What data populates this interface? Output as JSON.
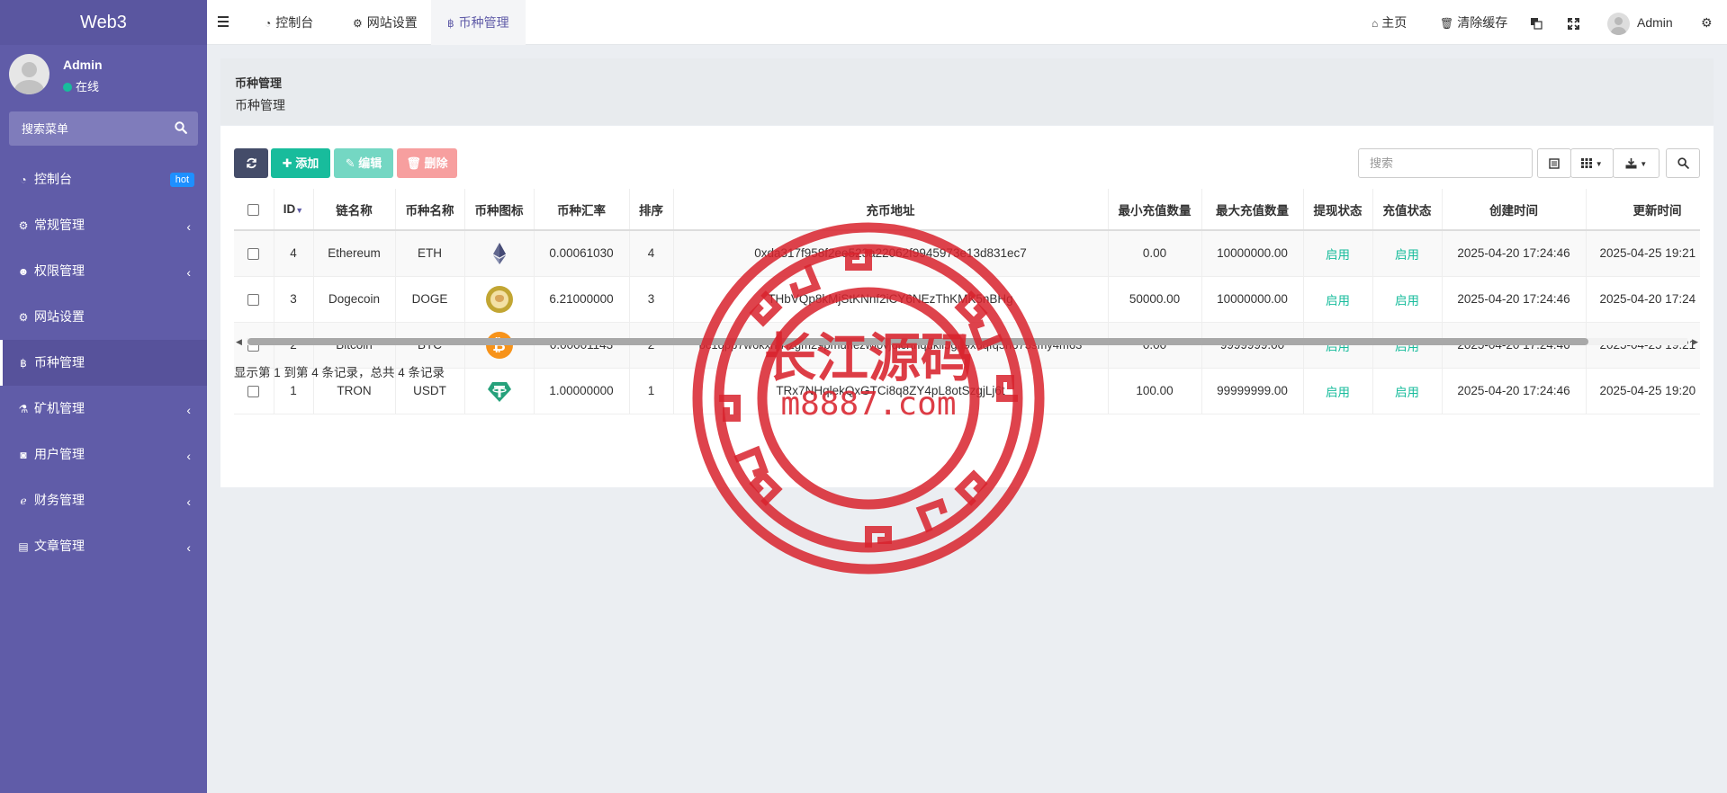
{
  "app": {
    "brand": "Web3"
  },
  "user": {
    "name": "Admin",
    "status": "在线"
  },
  "sidebar": {
    "search_placeholder": "搜索菜单",
    "items": [
      {
        "label": "控制台",
        "icon": "dashboard-icon",
        "badge": "hot"
      },
      {
        "label": "常规管理",
        "icon": "cogs-icon"
      },
      {
        "label": "权限管理",
        "icon": "group-icon"
      },
      {
        "label": "网站设置",
        "icon": "cogs-icon"
      },
      {
        "label": "币种管理",
        "icon": "bitcoin-icon"
      },
      {
        "label": "矿机管理",
        "icon": "flask-icon"
      },
      {
        "label": "用户管理",
        "icon": "instagram-icon"
      },
      {
        "label": "财务管理",
        "icon": "internet-explorer-icon"
      },
      {
        "label": "文章管理",
        "icon": "book-icon"
      }
    ]
  },
  "header": {
    "tabs": [
      {
        "label": "控制台",
        "icon": "dashboard-icon"
      },
      {
        "label": "网站设置",
        "icon": "cogs-icon"
      },
      {
        "label": "币种管理",
        "icon": "bitcoin-icon"
      }
    ],
    "home": "主页",
    "clear_cache": "清除缓存",
    "admin": "Admin"
  },
  "page": {
    "title": "币种管理",
    "subtitle": "币种管理"
  },
  "toolbar": {
    "add": "添加",
    "edit": "编辑",
    "delete": "删除",
    "search_placeholder": "搜索"
  },
  "table": {
    "columns": [
      "ID",
      "链名称",
      "币种名称",
      "币种图标",
      "币种汇率",
      "排序",
      "充币地址",
      "最小充值数量",
      "最大充值数量",
      "提现状态",
      "充值状态",
      "创建时间",
      "更新时间"
    ],
    "rows": [
      {
        "id": "4",
        "chain": "Ethereum",
        "coin": "ETH",
        "icon": "ethereum-icon",
        "rate": "0.00061030",
        "sort": "4",
        "address": "0xda317f958f2ee523a22062f9945973e13d831ec7",
        "min": "0.00",
        "max": "10000000.00",
        "withdraw": "启用",
        "deposit": "启用",
        "created": "2025-04-20 17:24:46",
        "updated": "2025-04-25 19:21"
      },
      {
        "id": "3",
        "chain": "Dogecoin",
        "coin": "DOGE",
        "icon": "dogecoin-icon",
        "rate": "6.21000000",
        "sort": "3",
        "address": "THbVQp8kMjStKNnf2iCY6NEzThKMK5nBHg",
        "min": "50000.00",
        "max": "10000000.00",
        "withdraw": "启用",
        "deposit": "启用",
        "created": "2025-04-20 17:24:46",
        "updated": "2025-04-20 17:24"
      },
      {
        "id": "2",
        "chain": "Bitcoin",
        "coin": "BTC",
        "icon": "bitcoin-icon",
        "rate": "0.00001143",
        "sort": "2",
        "address": "bc1qpp7w6kxnj7lzgm29pmuhezwl0vjdlcrthqukll5gn9xuqfq5n673smy4m63",
        "min": "0.00",
        "max": "9999999.00",
        "withdraw": "启用",
        "deposit": "启用",
        "created": "2025-04-20 17:24:46",
        "updated": "2025-04-25 19:21"
      },
      {
        "id": "1",
        "chain": "TRON",
        "coin": "USDT",
        "icon": "tether-icon",
        "rate": "1.00000000",
        "sort": "1",
        "address": "TRx7NHqlekQxGTCi8q8ZY4pL8otSzgjLj6t",
        "min": "100.00",
        "max": "99999999.00",
        "withdraw": "启用",
        "deposit": "启用",
        "created": "2025-04-20 17:24:46",
        "updated": "2025-04-25 19:20"
      }
    ],
    "footer": "显示第 1 到第 4 条记录，总共 4 条记录"
  },
  "watermark": {
    "text": "长江源码",
    "domain": "m8887.com",
    "color": "#d9232d"
  }
}
